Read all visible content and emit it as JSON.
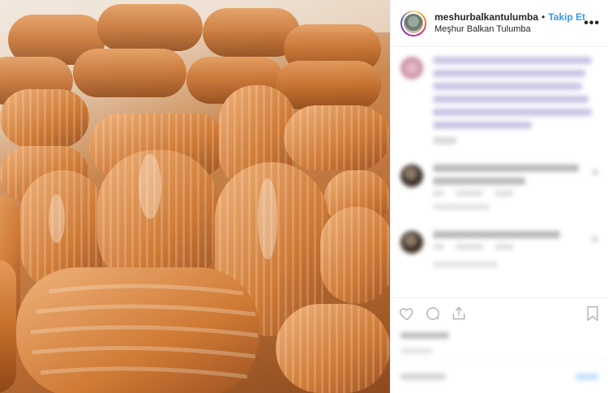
{
  "post": {
    "image_alt": "",
    "header": {
      "username": "meshurbalkantulumba",
      "separator": "•",
      "follow_label": "Takip Et",
      "full_name": "Meşhur Balkan Tulumba",
      "more_label": "•••"
    }
  },
  "icons": {
    "like": "heart-icon",
    "comment": "comment-icon",
    "share": "share-icon",
    "save": "bookmark-icon",
    "options": "more-options-icon"
  },
  "colors": {
    "accent": "#3897f0",
    "text": "#262626",
    "border": "#efefef"
  }
}
